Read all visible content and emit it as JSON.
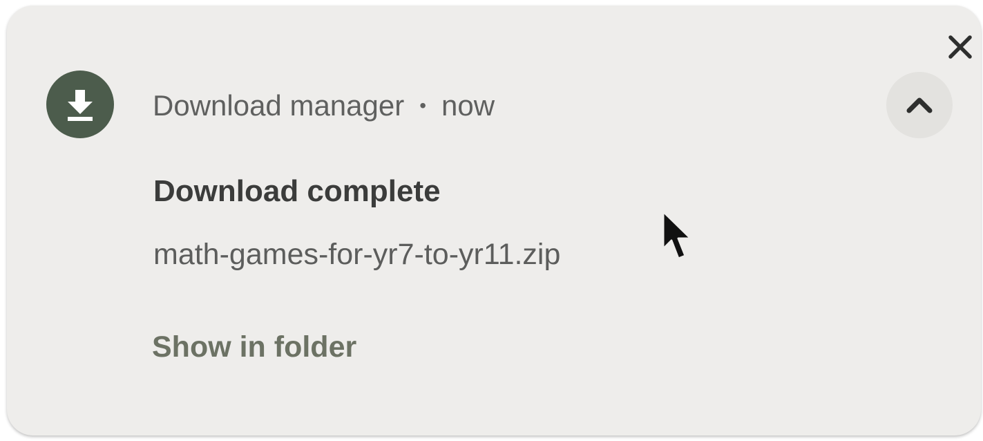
{
  "notification": {
    "app_name": "Download manager",
    "separator": "•",
    "time": "now",
    "title": "Download complete",
    "message": "math-games-for-yr7-to-yr11.zip",
    "action_label": "Show in folder",
    "icons": {
      "app": "download-icon",
      "expand": "chevron-up-icon",
      "close": "close-icon"
    },
    "colors": {
      "background": "#eeedeb",
      "app_icon_bg": "#4c5c4c",
      "action_text": "#6c7264"
    }
  }
}
